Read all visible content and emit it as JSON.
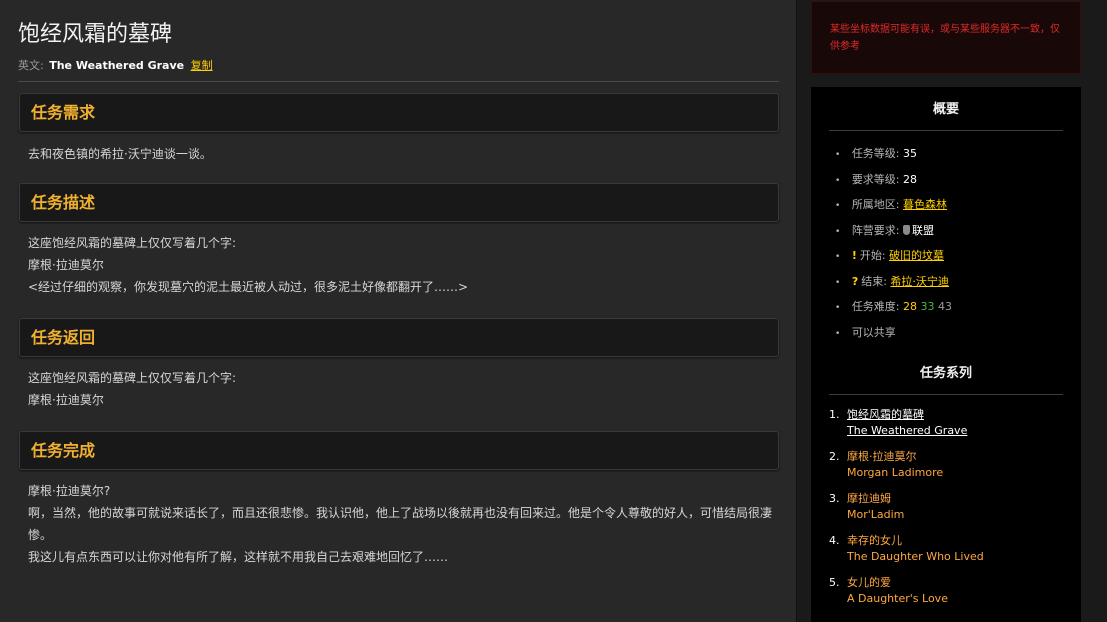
{
  "title": "饱经风霜的墓碑",
  "subtitle": {
    "label": "英文:",
    "english_name": "The Weathered Grave",
    "copy_label": "复制"
  },
  "sections": [
    {
      "heading": "任务需求",
      "lines": [
        "去和夜色镇的希拉·沃宁迪谈一谈。"
      ]
    },
    {
      "heading": "任务描述",
      "lines": [
        "这座饱经风霜的墓碑上仅仅写着几个字:",
        "摩根·拉迪莫尔",
        "<经过仔细的观察，你发现墓穴的泥土最近被人动过，很多泥土好像都翻开了……>"
      ]
    },
    {
      "heading": "任务返回",
      "lines": [
        "这座饱经风霜的墓碑上仅仅写着几个字:",
        "摩根·拉迪莫尔"
      ]
    },
    {
      "heading": "任务完成",
      "lines": [
        "摩根·拉迪莫尔?",
        "啊，当然，他的故事可就说来话长了，而且还很悲惨。我认识他，他上了战场以後就再也没有回来过。他是个令人尊敬的好人，可惜结局很凄惨。",
        "我这儿有点东西可以让你对他有所了解，这样就不用我自己去艰难地回忆了……"
      ]
    }
  ],
  "alert": "某些坐标数据可能有误，或与某些服务器不一致，仅供参考",
  "summary": {
    "heading": "概要",
    "quest_level_label": "任务等级:",
    "quest_level": "35",
    "req_level_label": "要求等级:",
    "req_level": "28",
    "zone_label": "所属地区:",
    "zone": "暮色森林",
    "faction_label": "阵营要求:",
    "faction": "联盟",
    "start_label": "开始:",
    "start": "破旧的坟墓",
    "end_label": "结束:",
    "end": "希拉·沃宁迪",
    "difficulty_label": "任务难度:",
    "difficulty": [
      "28",
      "33",
      "43"
    ],
    "shareable": "可以共享"
  },
  "series": {
    "heading": "任务系列",
    "items": [
      {
        "num": "1.",
        "cn": "饱经风霜的墓碑",
        "en": "The Weathered Grave"
      },
      {
        "num": "2.",
        "cn": "摩根·拉迪莫尔",
        "en": "Morgan Ladimore"
      },
      {
        "num": "3.",
        "cn": "摩拉迪姆",
        "en": "Mor'Ladim"
      },
      {
        "num": "4.",
        "cn": "幸存的女儿",
        "en": "The Daughter Who Lived"
      },
      {
        "num": "5.",
        "cn": "女儿的爱",
        "en": "A Daughter's Love"
      }
    ]
  },
  "colors": {
    "accent": "#f0b030",
    "link": "#ffd100",
    "alert": "#e02a2a",
    "series_link": "#ffa840"
  }
}
